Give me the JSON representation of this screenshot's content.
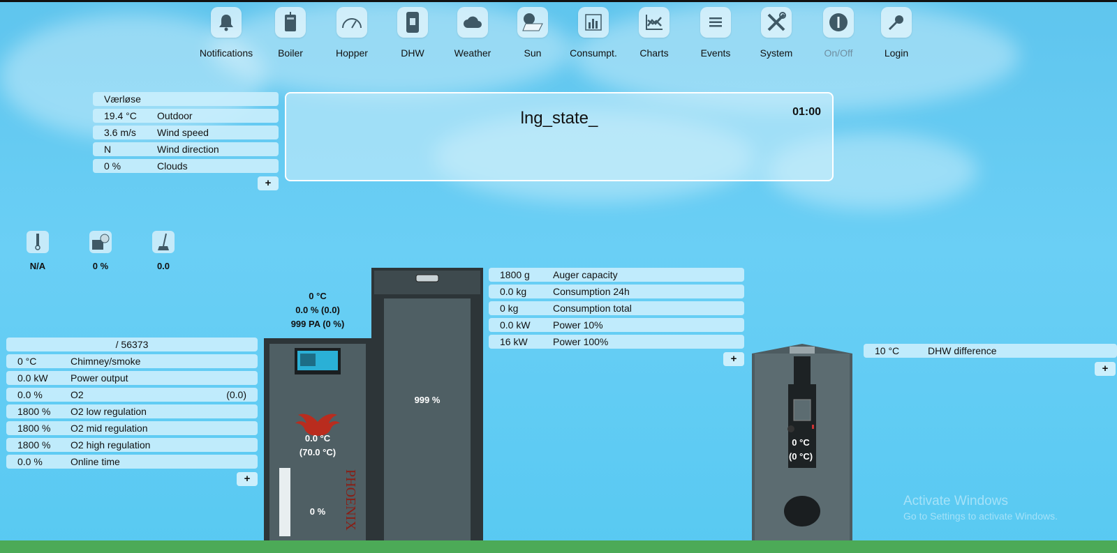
{
  "nav": {
    "items": [
      {
        "label": "Notifications",
        "icon": "bell-icon"
      },
      {
        "label": "Boiler",
        "icon": "boiler-icon"
      },
      {
        "label": "Hopper",
        "icon": "gauge-icon"
      },
      {
        "label": "DHW",
        "icon": "water-tank-icon"
      },
      {
        "label": "Weather",
        "icon": "cloud-icon"
      },
      {
        "label": "Sun",
        "icon": "solar-panel-icon"
      },
      {
        "label": "Consumpt.",
        "icon": "bar-chart-icon"
      },
      {
        "label": "Charts",
        "icon": "line-chart-icon"
      },
      {
        "label": "Events",
        "icon": "list-icon"
      },
      {
        "label": "System",
        "icon": "tools-icon"
      },
      {
        "label": "On/Off",
        "icon": "power-icon"
      },
      {
        "label": "Login",
        "icon": "key-icon"
      }
    ]
  },
  "weather": {
    "location": "Værløse",
    "rows": [
      {
        "value": "19.4 °C",
        "label": "Outdoor"
      },
      {
        "value": "3.6 m/s",
        "label": "Wind speed"
      },
      {
        "value": "N",
        "label": "Wind direction"
      },
      {
        "value": "0 %",
        "label": "Clouds"
      }
    ],
    "plus": "+"
  },
  "state": {
    "title": "lng_state_",
    "time": "01:00"
  },
  "small_icons": [
    {
      "icon": "sensor-icon",
      "value": "N/A"
    },
    {
      "icon": "hopper-fan-icon",
      "value": "0 %"
    },
    {
      "icon": "sweep-icon",
      "value": "0.0"
    }
  ],
  "boiler_top": {
    "line1": "0 °C",
    "line2": "0.0 % (0.0)",
    "line3": "999 PA (0 %)"
  },
  "boiler_panel": {
    "header": "/ 56373",
    "rows": [
      {
        "value": "0 °C",
        "label": "Chimney/smoke",
        "right": ""
      },
      {
        "value": "0.0 kW",
        "label": "Power output",
        "right": ""
      },
      {
        "value": "0.0 %",
        "label": "O2",
        "right": "(0.0)"
      },
      {
        "value": "1800 %",
        "label": "O2 low regulation",
        "right": ""
      },
      {
        "value": "1800 %",
        "label": "O2 mid regulation",
        "right": ""
      },
      {
        "value": "1800 %",
        "label": "O2 high regulation",
        "right": ""
      },
      {
        "value": "0.0 %",
        "label": "Online time",
        "right": ""
      }
    ],
    "plus": "+"
  },
  "boiler_body": {
    "temp": "0.0 °C",
    "temp_set": "(70.0 °C)",
    "level": "0 %",
    "brand": "PHOENIX"
  },
  "hopper": {
    "level": "999 %"
  },
  "hopper_panel": {
    "rows": [
      {
        "value": "1800 g",
        "label": "Auger capacity"
      },
      {
        "value": "0.0 kg",
        "label": "Consumption 24h"
      },
      {
        "value": "0 kg",
        "label": "Consumption total"
      },
      {
        "value": "0.0 kW",
        "label": "Power 10%"
      },
      {
        "value": "16 kW",
        "label": "Power 100%"
      }
    ],
    "plus": "+"
  },
  "dhw": {
    "temp": "0 °C",
    "temp_set": "(0 °C)"
  },
  "dhw_panel": {
    "rows": [
      {
        "value": "10 °C",
        "label": "DHW difference"
      }
    ],
    "plus": "+"
  },
  "watermark": {
    "line1": "Activate Windows",
    "line2": "Go to Settings to activate Windows."
  }
}
